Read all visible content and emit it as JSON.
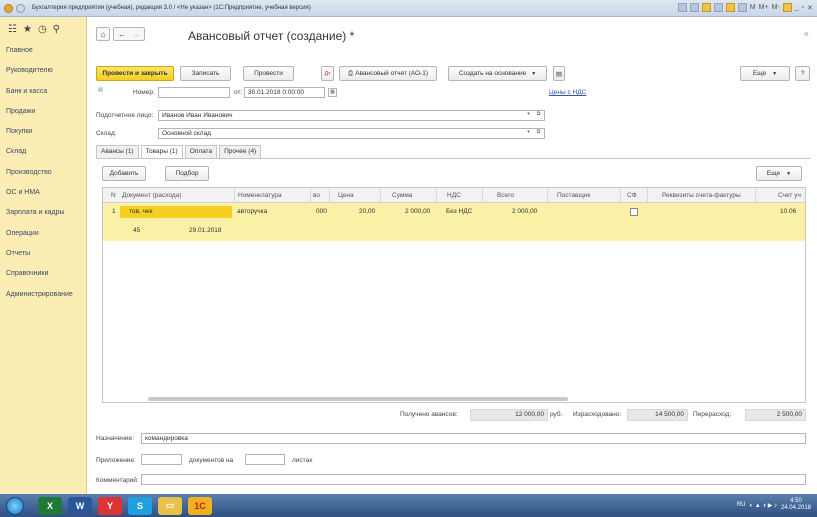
{
  "window": {
    "title": "Бухгалтерия предприятия (учебная), редакция 3.0 / <Не указан> (1С:Предприятие, учебная версия)",
    "right_buttons": [
      "M",
      "M+",
      "M-"
    ]
  },
  "sidebar": {
    "items": [
      {
        "label": "Главное"
      },
      {
        "label": "Руководителю"
      },
      {
        "label": "Банк и касса"
      },
      {
        "label": "Продажи"
      },
      {
        "label": "Покупки"
      },
      {
        "label": "Склад"
      },
      {
        "label": "Производство"
      },
      {
        "label": "ОС и НМА"
      },
      {
        "label": "Зарплата и кадры"
      },
      {
        "label": "Операции"
      },
      {
        "label": "Отчеты"
      },
      {
        "label": "Справочники"
      },
      {
        "label": "Администрирование"
      }
    ]
  },
  "document": {
    "title": "Авансовый отчет (создание) *",
    "close": "×"
  },
  "toolbar": {
    "post_close": "Провести и закрыть",
    "save": "Записать",
    "post": "Провести",
    "print_form": "Авансовый отчет (АО-1)",
    "create_based": "Создать на основание",
    "more": "Еще",
    "help": "?"
  },
  "header": {
    "number_label": "Номер:",
    "number_value": "",
    "date_label": "от:",
    "date_value": "30.01.2018  0:00:00",
    "prices_link": "Цены с НДС",
    "person_label": "Подотчетное лицо:",
    "person_value": "Иванов Иван Иванович",
    "warehouse_label": "Склад:",
    "warehouse_value": "Основной склад"
  },
  "tabs": [
    {
      "label": "Авансы (1)"
    },
    {
      "label": "Товары (1)"
    },
    {
      "label": "Оплата"
    },
    {
      "label": "Прочее (4)"
    }
  ],
  "table_toolbar": {
    "add": "Добавить",
    "pick": "Подбор",
    "more": "Еще"
  },
  "table": {
    "columns": [
      "N",
      "Документ (расхода)",
      "Номенклатура",
      "во",
      "Цена",
      "Сумма",
      "НДС",
      "Всего",
      "Поставщик",
      "СФ",
      "Реквизиты счета-фактуры",
      "Счет уч"
    ],
    "rows": [
      {
        "n": "1",
        "doc": "тов. чек",
        "doc_num": "45",
        "doc_date": "29.01.2018",
        "item": "авторучка",
        "qty": "000",
        "price": "20,00",
        "sum": "2 000,00",
        "vat": "Без НДС",
        "total": "2 000,00",
        "supplier": "",
        "account": "10.06"
      }
    ]
  },
  "totals": {
    "received_label": "Получено авансов:",
    "received_value": "12 000,00",
    "currency": "руб.",
    "spent_label": "Израсходовано:",
    "spent_value": "14 500,00",
    "overspent_label": "Перерасход:",
    "overspent_value": "2 500,00"
  },
  "footer": {
    "purpose_label": "Назначение:",
    "purpose_value": "командировка",
    "attachment_label": "Приложение:",
    "docs_on": "документов на",
    "sheets": "листах",
    "comment_label": "Комментарий:"
  },
  "taskbar": {
    "lang": "RU",
    "time": "4:50",
    "date": "24.04.2018"
  },
  "colors": {
    "sidebar_bg": "#fbedb3",
    "primary_button": "#f5cf22",
    "selected_row": "#fbf1a7",
    "link": "#3256a8"
  }
}
